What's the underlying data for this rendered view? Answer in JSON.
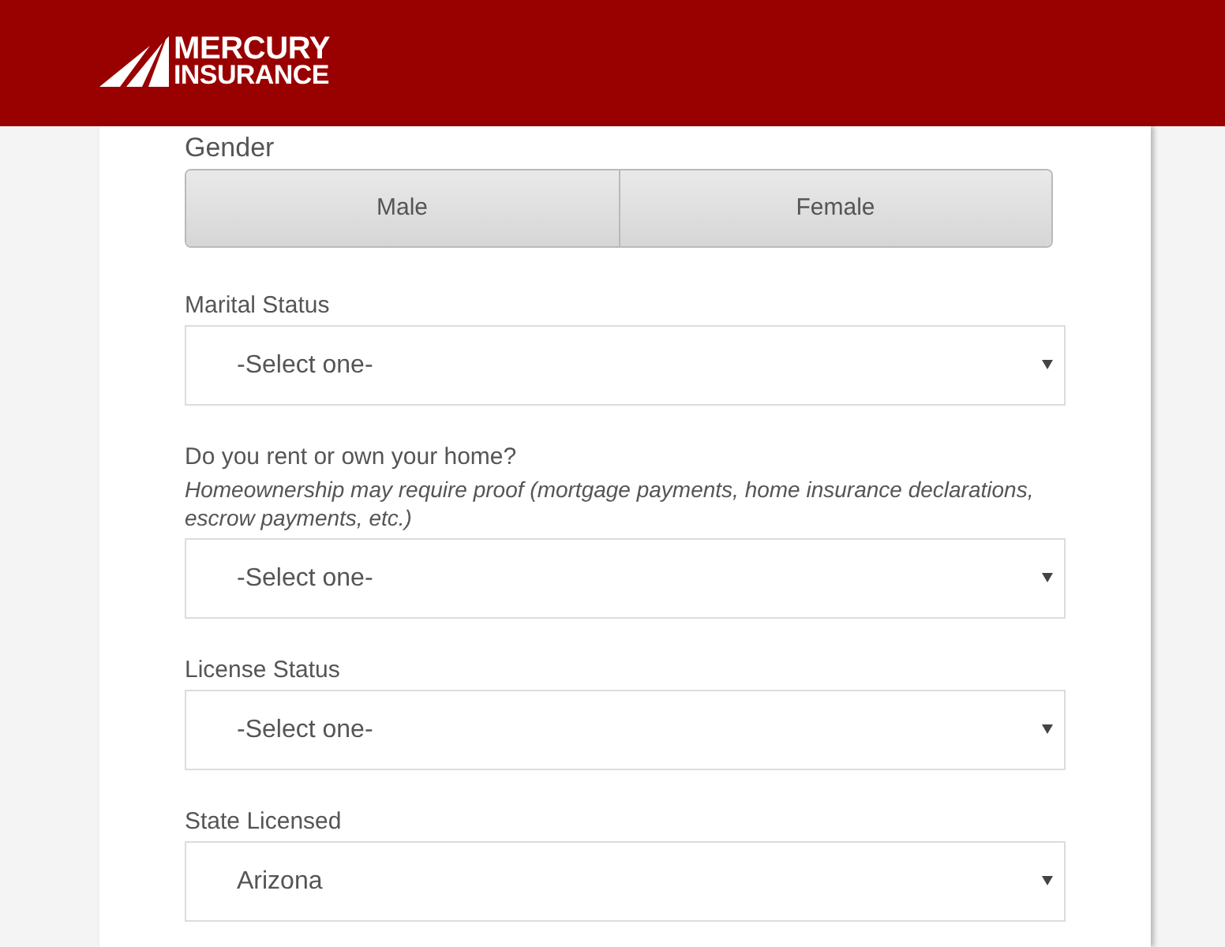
{
  "header": {
    "logo": {
      "line_1": "MERCURY",
      "line_2": "INSURANCE"
    }
  },
  "form": {
    "gender": {
      "label": "Gender",
      "options": [
        {
          "label": "Male",
          "selected": false
        },
        {
          "label": "Female",
          "selected": false
        }
      ]
    },
    "fields": [
      {
        "label": "Marital Status",
        "value": "-Select one-"
      },
      {
        "label": "Do you rent or own your home?",
        "hint": "Homeownership may require proof (mortgage payments, home insurance declarations, escrow payments, etc.)",
        "value": "-Select one-"
      },
      {
        "label": "License Status",
        "value": "-Select one-"
      },
      {
        "label": "State Licensed",
        "value": "Arizona"
      }
    ]
  }
}
